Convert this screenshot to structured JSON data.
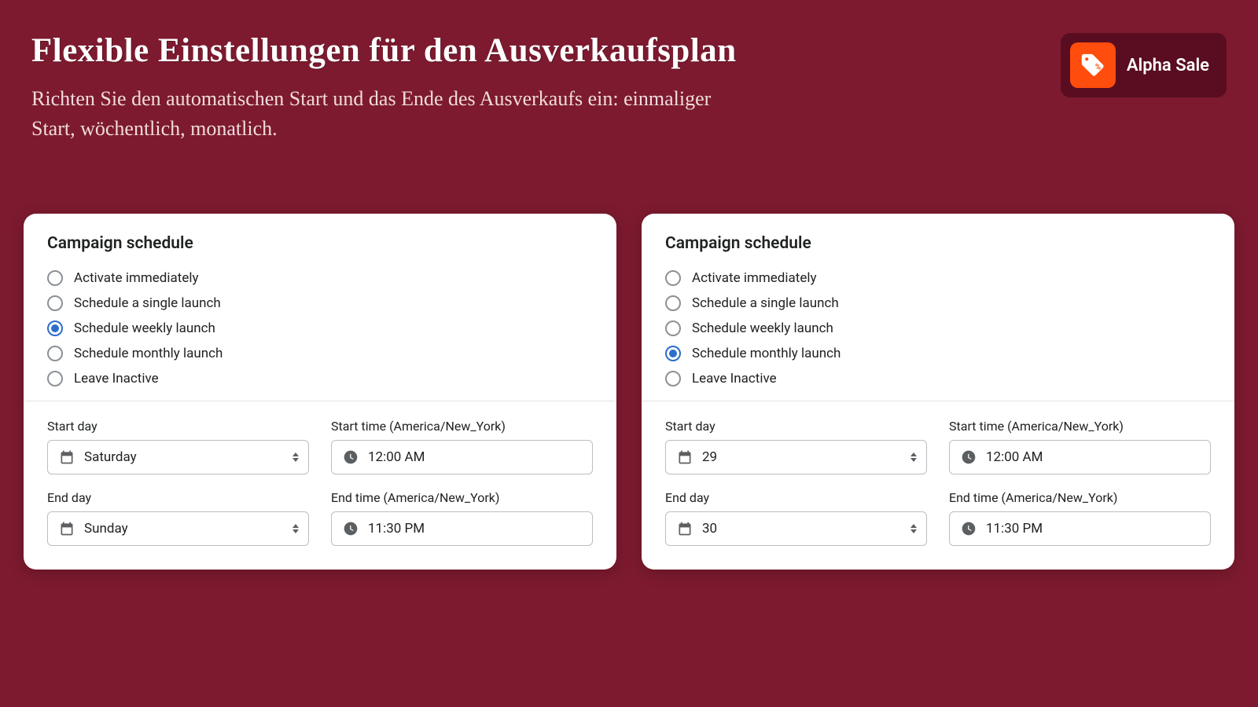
{
  "header": {
    "title": "Flexible Einstellungen für den Ausverkaufsplan",
    "subtitle": "Richten Sie den automatischen Start und das Ende des Ausverkaufs ein: einmaliger Start, wöchentlich, monatlich."
  },
  "brand": {
    "name": "Alpha Sale"
  },
  "radio_options": [
    "Activate immediately",
    "Schedule a single launch",
    "Schedule weekly launch",
    "Schedule monthly launch",
    "Leave Inactive"
  ],
  "panels": [
    {
      "title": "Campaign schedule",
      "selected_index": 2,
      "fields": {
        "start_day_label": "Start day",
        "start_day_value": "Saturday",
        "start_time_label": "Start time (America/New_York)",
        "start_time_value": "12:00 AM",
        "end_day_label": "End day",
        "end_day_value": "Sunday",
        "end_time_label": "End time (America/New_York)",
        "end_time_value": "11:30 PM"
      }
    },
    {
      "title": "Campaign schedule",
      "selected_index": 3,
      "fields": {
        "start_day_label": "Start day",
        "start_day_value": "29",
        "start_time_label": "Start time (America/New_York)",
        "start_time_value": "12:00 AM",
        "end_day_label": "End day",
        "end_day_value": "30",
        "end_time_label": "End time (America/New_York)",
        "end_time_value": "11:30 PM"
      }
    }
  ]
}
